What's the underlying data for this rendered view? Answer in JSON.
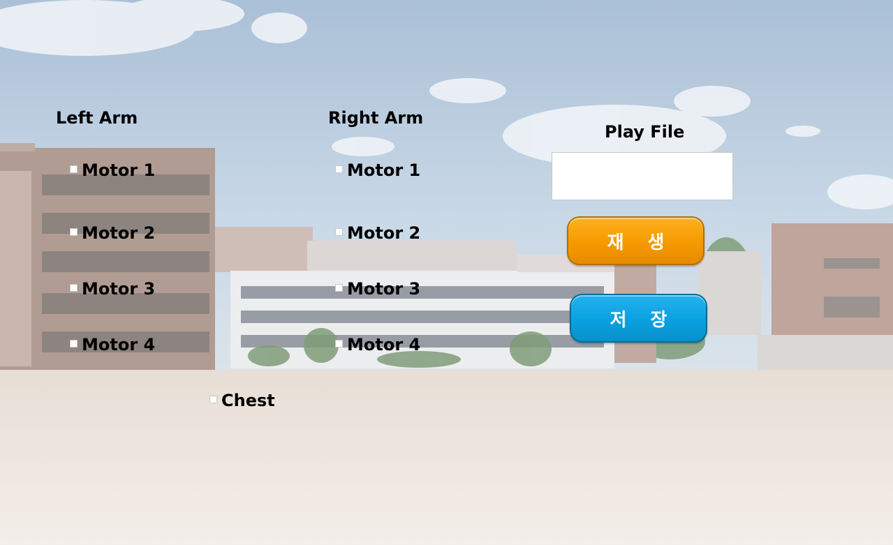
{
  "left_arm": {
    "title": "Left Arm",
    "motors": [
      "Motor 1",
      "Motor 2",
      "Motor 3",
      "Motor 4"
    ]
  },
  "right_arm": {
    "title": "Right Arm",
    "motors": [
      "Motor 1",
      "Motor 2",
      "Motor 3",
      "Motor 4"
    ]
  },
  "chest": {
    "label": "Chest"
  },
  "play_file": {
    "title": "Play File",
    "value": ""
  },
  "buttons": {
    "play_label": "재생",
    "save_label": "저장",
    "play_color": "#f59a00",
    "save_color": "#0aa0e0"
  },
  "icons": [
    "checkbox"
  ]
}
